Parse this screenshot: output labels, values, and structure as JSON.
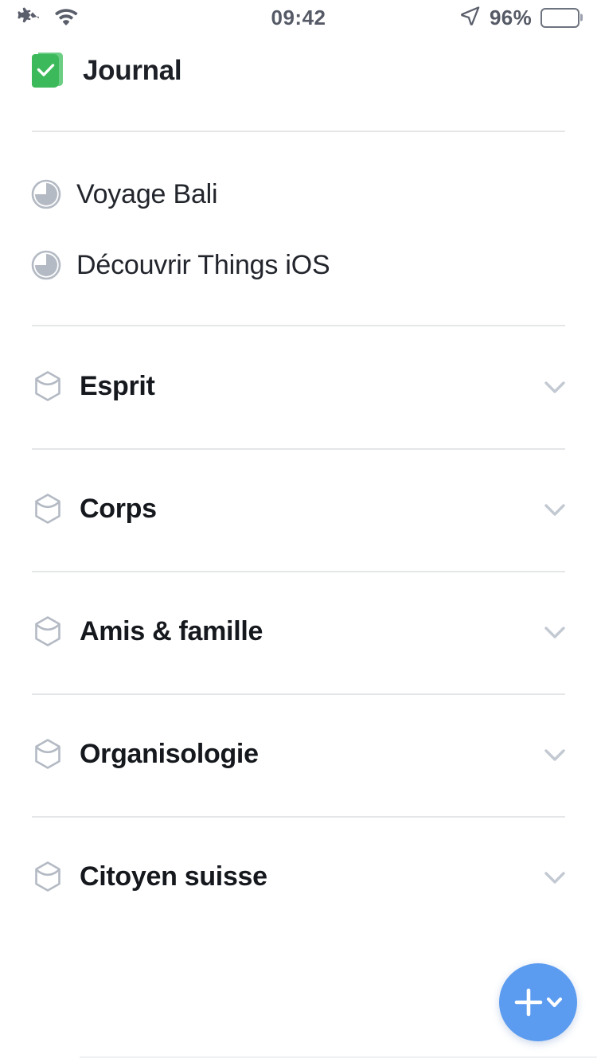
{
  "status_bar": {
    "airplane_icon": "airplane-icon",
    "wifi_icon": "wifi-icon",
    "time": "09:42",
    "location_icon": "location-arrow-icon",
    "battery_percent": "96%",
    "battery_level": 96
  },
  "header": {
    "icon": "logbook-icon",
    "title": "Journal"
  },
  "projects": [
    {
      "label": "Voyage Bali",
      "icon": "progress-pie-icon",
      "progress": 75
    },
    {
      "label": "Découvrir Things iOS",
      "icon": "progress-pie-icon",
      "progress": 75
    }
  ],
  "areas": [
    {
      "label": "Esprit",
      "icon": "area-hexagon-icon",
      "chevron": "chevron-down-icon"
    },
    {
      "label": "Corps",
      "icon": "area-hexagon-icon",
      "chevron": "chevron-down-icon"
    },
    {
      "label": "Amis & famille",
      "icon": "area-hexagon-icon",
      "chevron": "chevron-down-icon"
    },
    {
      "label": "Organisologie",
      "icon": "area-hexagon-icon",
      "chevron": "chevron-down-icon"
    },
    {
      "label": "Citoyen suisse",
      "icon": "area-hexagon-icon",
      "chevron": "chevron-down-icon"
    }
  ],
  "fab": {
    "plus_icon": "plus-icon",
    "chevron_icon": "chevron-down-icon"
  },
  "colors": {
    "accent_blue": "#5b9bf0",
    "logbook_green": "#3cb95a",
    "icon_gray": "#b4bac4",
    "divider": "#e4e6e8",
    "text_primary": "#1d2026",
    "status_gray": "#555a66"
  }
}
